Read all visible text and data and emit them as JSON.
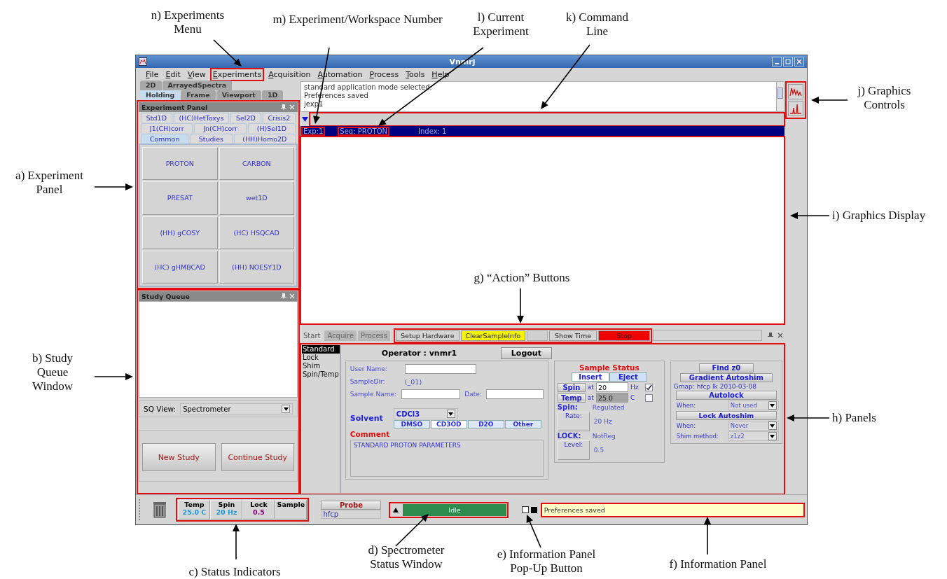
{
  "annotations": [
    {
      "label": "n) Experiments Menu"
    },
    {
      "label": "m) Experiment/Workspace Number"
    },
    {
      "label": "l) Current Experiment"
    },
    {
      "label": "k) Command Line"
    },
    {
      "label": "j) Graphics Controls"
    },
    {
      "label": "a) Experiment Panel"
    },
    {
      "label": "i) Graphics Display"
    },
    {
      "label": "g) “Action” Buttons"
    },
    {
      "label": "b) Study Queue Window"
    },
    {
      "label": "h) Panels"
    },
    {
      "label": "c) Status Indicators"
    },
    {
      "label": "d) Spectrometer Status Window"
    },
    {
      "label": "e) Information Panel Pop-Up Button"
    },
    {
      "label": "f) Information Panel"
    }
  ],
  "window": {
    "title": "Vnmrj"
  },
  "menu": [
    "File",
    "Edit",
    "View",
    "Experiments",
    "Acquisition",
    "Automation",
    "Process",
    "Tools",
    "Help"
  ],
  "viewport_tabs": [
    [
      {
        "label": "2D",
        "selected": false
      },
      {
        "label": "ArrayedSpectra",
        "selected": false
      }
    ],
    [
      {
        "label": "Holding",
        "selected": true
      },
      {
        "label": "Frame",
        "selected": false
      },
      {
        "label": "Viewport",
        "selected": false
      },
      {
        "label": "1D",
        "selected": false
      }
    ]
  ],
  "experiment_panel": {
    "title": "Experiment Panel",
    "tab_rows": [
      [
        {
          "label": "Std1D",
          "selected": false
        },
        {
          "label": "(HC)HetToxys",
          "selected": false
        },
        {
          "label": "Sel2D",
          "selected": false
        },
        {
          "label": "Crisis2",
          "selected": false
        }
      ],
      [
        {
          "label": "J1(CH)corr",
          "selected": false
        },
        {
          "label": "Jn(CH)corr",
          "selected": false
        },
        {
          "label": "(H)Sel1D",
          "selected": false
        }
      ],
      [
        {
          "label": "Common",
          "selected": true
        },
        {
          "label": "Studies",
          "selected": false
        },
        {
          "label": "(HH)Homo2D",
          "selected": false
        }
      ]
    ],
    "buttons": [
      "PROTON",
      "CARBON",
      "PRESAT",
      "wet1D",
      "(HH) gCOSY",
      "(HC) HSQCAD",
      "(HC) gHMBCAD",
      "(HH) NOESY1D"
    ]
  },
  "study_queue": {
    "title": "Study Queue",
    "view_label": "SQ View:",
    "view_value": "Spectrometer",
    "buttons": [
      "New Study",
      "Continue Study"
    ]
  },
  "console": [
    "standard application mode selected.",
    "Preferences saved",
    "jexp1"
  ],
  "exp_bar": {
    "exp": "Exp:1",
    "seq": "Seq: PROTON",
    "index": "Index: 1"
  },
  "action_bar": {
    "tabs": [
      {
        "label": "Start",
        "selected": true
      },
      {
        "label": "Acquire",
        "selected": false
      },
      {
        "label": "Process",
        "selected": false
      }
    ],
    "buttons": [
      {
        "label": "Setup Hardware",
        "color": "#d4d4d4"
      },
      {
        "label": "ClearSampleInfo",
        "color": "#f4f400"
      },
      {
        "label": "Show Time",
        "color": "#d4d4d4"
      },
      {
        "label": "Stop",
        "color": "#f00000"
      }
    ]
  },
  "panels": {
    "nav": [
      {
        "label": "Standard",
        "selected": true
      },
      {
        "label": "Lock",
        "selected": false
      },
      {
        "label": "Shim",
        "selected": false
      },
      {
        "label": "Spin/Temp",
        "selected": false
      }
    ],
    "operator": "Operator : vnmr1",
    "logout": "Logout",
    "user_name_label": "User Name:",
    "sample_dir_label": "SampleDir:",
    "sample_dir": "(_01)",
    "sample_name_label": "Sample Name:",
    "date_label": "Date:",
    "solvent_label": "Solvent",
    "solvent": "CDCl3",
    "solvent_buttons": [
      {
        "label": "DMSO",
        "selected": false
      },
      {
        "label": "CD3OD",
        "selected": true
      },
      {
        "label": "D2O",
        "selected": false
      },
      {
        "label": "Other",
        "selected": false
      }
    ],
    "comment_label": "Comment",
    "comment": "STANDARD PROTON PARAMETERS",
    "sample_status": {
      "title": "Sample Status",
      "insert": "Insert",
      "eject": "Eject",
      "rows": [
        {
          "button": "Spin",
          "at": "at",
          "value": "20",
          "unit": "Hz",
          "checked": true,
          "disabled": false
        },
        {
          "button": "Temp",
          "at": "at",
          "value": "25.0",
          "unit": "C",
          "checked": false,
          "disabled": true
        }
      ],
      "spin_label": "Spin:",
      "spin": "Regulated",
      "rate_label": "Rate:",
      "rate": "20 Hz",
      "lock_label": "LOCK:",
      "lock": "NotReg",
      "level_label": "Level:",
      "level": "0.5"
    },
    "shim": {
      "find_z0": "Find z0",
      "gradient": "Gradient Autoshim",
      "gmap": "Gmap: hfcp lk 2010-03-08",
      "autolock": "Autolock",
      "when_label": "When:",
      "when": "Not used",
      "lock_autoshim": "Lock Autoshim",
      "when2_label": "When:",
      "when2": "Never",
      "method_label": "Shim method:",
      "method": "z1z2"
    }
  },
  "status_bar": {
    "indicators": [
      {
        "label": "Temp",
        "value": "25.0 C",
        "color": "#1a9ad6"
      },
      {
        "label": "Spin",
        "value": "20 Hz",
        "color": "#1a9ad6"
      },
      {
        "label": "Lock",
        "value": "0.5",
        "color": "#800080"
      },
      {
        "label": "Sample"
      }
    ],
    "probe_label": "Probe",
    "probe": "hfcp",
    "status": "Idle",
    "info": "Preferences saved"
  }
}
